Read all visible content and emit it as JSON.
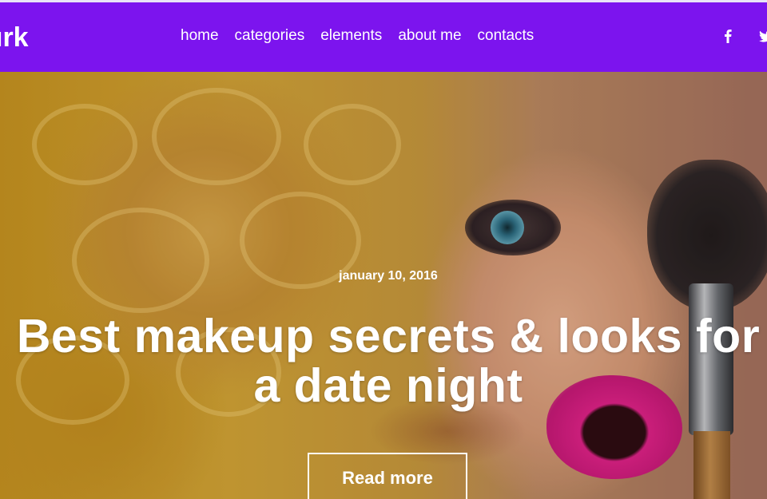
{
  "header": {
    "logo_text": "ırk",
    "nav": [
      {
        "label": "home"
      },
      {
        "label": "categories"
      },
      {
        "label": "elements"
      },
      {
        "label": "about me"
      },
      {
        "label": "contacts"
      }
    ],
    "social": [
      {
        "icon": "facebook-icon",
        "glyph": "f"
      },
      {
        "icon": "twitter-icon",
        "glyph": "🐦"
      }
    ]
  },
  "hero": {
    "date": "january 10, 2016",
    "title": "Best makeup secrets & looks for a date night",
    "button_label": "Read more"
  },
  "colors": {
    "navbar": "#7c14ee",
    "text": "#ffffff"
  }
}
